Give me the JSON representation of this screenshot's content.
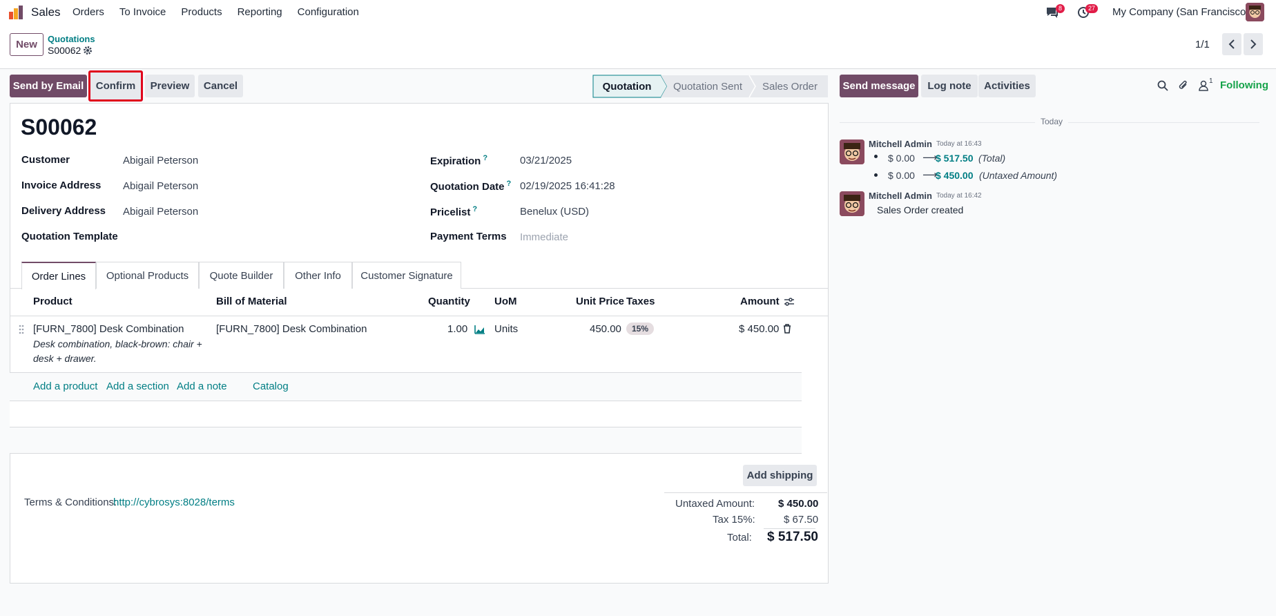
{
  "topbar": {
    "app_name": "Sales",
    "menu": [
      "Orders",
      "To Invoice",
      "Products",
      "Reporting",
      "Configuration"
    ],
    "messages_count": "8",
    "activities_count": "27",
    "company": "My Company (San Francisco)"
  },
  "control": {
    "new_label": "New",
    "breadcrumb_parent": "Quotations",
    "record_name": "S00062",
    "pager": "1/1"
  },
  "actions": {
    "send_email": "Send by Email",
    "confirm": "Confirm",
    "preview": "Preview",
    "cancel": "Cancel"
  },
  "status_steps": [
    "Quotation",
    "Quotation Sent",
    "Sales Order"
  ],
  "chatter_buttons": {
    "send_message": "Send message",
    "log_note": "Log note",
    "activities": "Activities",
    "followers_count": "1",
    "following": "Following"
  },
  "form": {
    "title": "S00062",
    "customer_label": "Customer",
    "customer": "Abigail Peterson",
    "invoice_label": "Invoice Address",
    "invoice": "Abigail Peterson",
    "delivery_label": "Delivery Address",
    "delivery": "Abigail Peterson",
    "template_label": "Quotation Template",
    "expiration_label": "Expiration",
    "expiration": "03/21/2025",
    "qdate_label": "Quotation Date",
    "qdate": "02/19/2025 16:41:28",
    "pricelist_label": "Pricelist",
    "pricelist": "Benelux (USD)",
    "payterms_label": "Payment Terms",
    "payterms": "Immediate",
    "qmark": "?"
  },
  "tabs": [
    "Order Lines",
    "Optional Products",
    "Quote Builder",
    "Other Info",
    "Customer Signature"
  ],
  "table": {
    "headers": {
      "product": "Product",
      "bom": "Bill of Material",
      "qty": "Quantity",
      "uom": "UoM",
      "price": "Unit Price",
      "taxes": "Taxes",
      "amount": "Amount"
    },
    "row": {
      "product": "[FURN_7800] Desk Combination",
      "desc1": "Desk combination, black-brown: chair +",
      "desc2": "desk + drawer.",
      "bom": "[FURN_7800] Desk Combination",
      "qty": "1.00",
      "uom": "Units",
      "price": "450.00",
      "tax": "15%",
      "amount": "$ 450.00"
    },
    "add_links": [
      "Add a product",
      "Add a section",
      "Add a note",
      "Catalog"
    ]
  },
  "footer": {
    "add_shipping": "Add shipping",
    "terms_label": "Terms & Conditions:",
    "terms_link": "http://cybrosys:8028/terms",
    "untaxed_label": "Untaxed Amount:",
    "untaxed": "$ 450.00",
    "tax_label": "Tax 15%:",
    "tax": "$ 67.50",
    "total_label": "Total:",
    "total": "$ 517.50"
  },
  "chatter": {
    "date_sep": "Today",
    "msg1_author": "Mitchell Admin",
    "msg1_time": "Today at 16:43",
    "msg1_old1": "$ 0.00",
    "msg1_new1": "$ 517.50",
    "msg1_field1": "(Total)",
    "msg1_old2": "$ 0.00",
    "msg1_new2": "$ 450.00",
    "msg1_field2": "(Untaxed Amount)",
    "msg2_author": "Mitchell Admin",
    "msg2_time": "Today at 16:42",
    "msg2_body": "Sales Order created",
    "arrow": "⟶"
  },
  "colors": {
    "primary": "#714b67",
    "link": "#017e84",
    "badge": "#e11d48"
  }
}
